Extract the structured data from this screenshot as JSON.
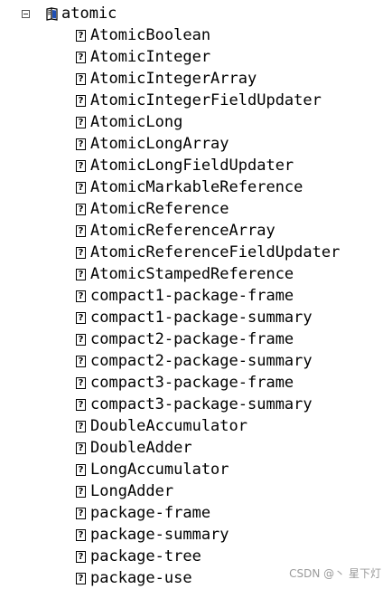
{
  "tree": {
    "root": {
      "label": "atomic",
      "expanded": true,
      "toggle_icon": "minus-box-icon",
      "icon": "book-folder-icon",
      "children": [
        {
          "label": "AtomicBoolean",
          "icon_glyph": "?"
        },
        {
          "label": "AtomicInteger",
          "icon_glyph": "?"
        },
        {
          "label": "AtomicIntegerArray",
          "icon_glyph": "?"
        },
        {
          "label": "AtomicIntegerFieldUpdater",
          "icon_glyph": "?"
        },
        {
          "label": "AtomicLong",
          "icon_glyph": "?"
        },
        {
          "label": "AtomicLongArray",
          "icon_glyph": "?"
        },
        {
          "label": "AtomicLongFieldUpdater",
          "icon_glyph": "?"
        },
        {
          "label": "AtomicMarkableReference",
          "icon_glyph": "?"
        },
        {
          "label": "AtomicReference",
          "icon_glyph": "?"
        },
        {
          "label": "AtomicReferenceArray",
          "icon_glyph": "?"
        },
        {
          "label": "AtomicReferenceFieldUpdater",
          "icon_glyph": "?"
        },
        {
          "label": "AtomicStampedReference",
          "icon_glyph": "?"
        },
        {
          "label": "compact1-package-frame",
          "icon_glyph": "?"
        },
        {
          "label": "compact1-package-summary",
          "icon_glyph": "?"
        },
        {
          "label": "compact2-package-frame",
          "icon_glyph": "?"
        },
        {
          "label": "compact2-package-summary",
          "icon_glyph": "?"
        },
        {
          "label": "compact3-package-frame",
          "icon_glyph": "?"
        },
        {
          "label": "compact3-package-summary",
          "icon_glyph": "?"
        },
        {
          "label": "DoubleAccumulator",
          "icon_glyph": "?"
        },
        {
          "label": "DoubleAdder",
          "icon_glyph": "?"
        },
        {
          "label": "LongAccumulator",
          "icon_glyph": "?"
        },
        {
          "label": "LongAdder",
          "icon_glyph": "?"
        },
        {
          "label": "package-frame",
          "icon_glyph": "?"
        },
        {
          "label": "package-summary",
          "icon_glyph": "?"
        },
        {
          "label": "package-tree",
          "icon_glyph": "?"
        },
        {
          "label": "package-use",
          "icon_glyph": "?"
        }
      ]
    }
  },
  "watermark": {
    "text": "CSDN @丶 星下灯"
  },
  "colors": {
    "background": "#ffffff",
    "text": "#000000",
    "watermark": "#9a9a9a",
    "book_icon_blue": "#1f4fb4"
  }
}
